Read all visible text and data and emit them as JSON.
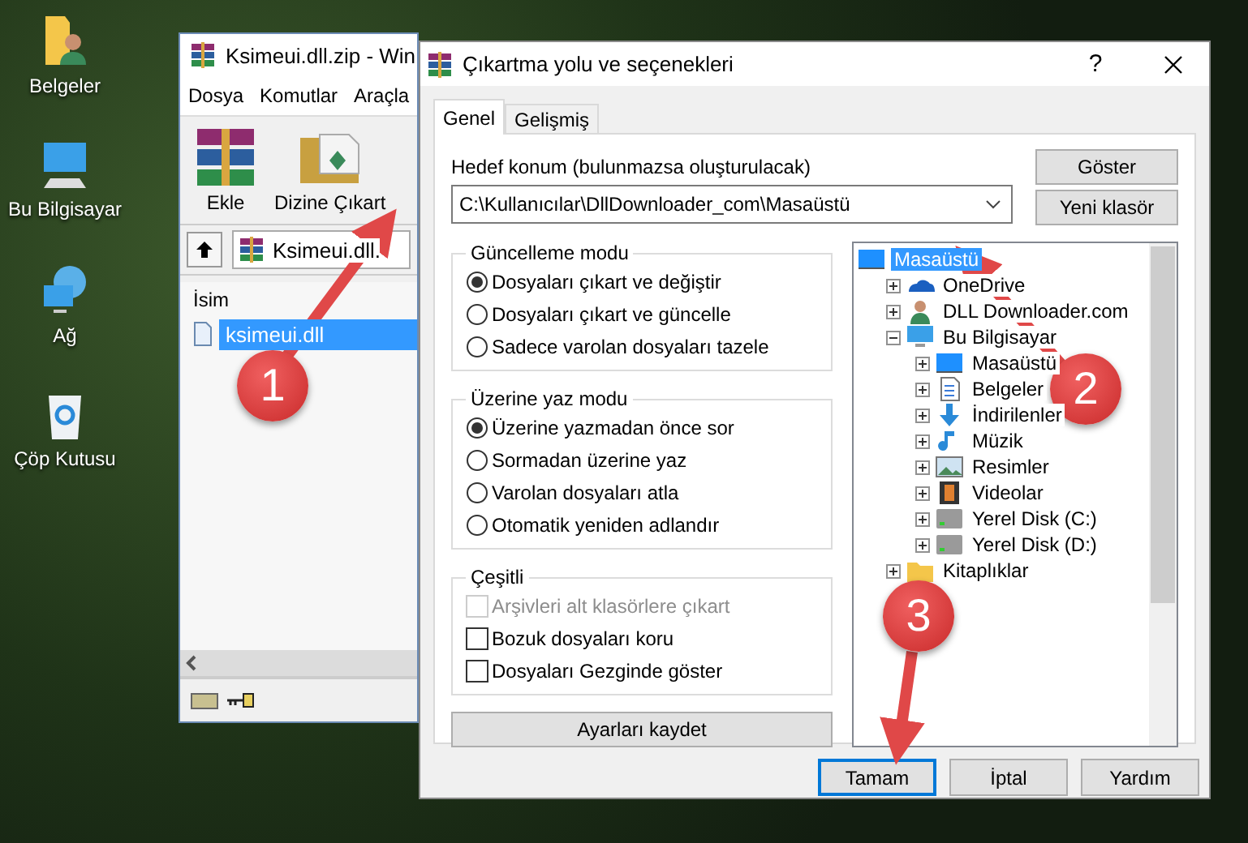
{
  "desktop_icons": [
    {
      "kind": "user-folder",
      "label": "Belgeler"
    },
    {
      "kind": "computer",
      "label": "Bu Bilgisayar"
    },
    {
      "kind": "network",
      "label": "Ağ"
    },
    {
      "kind": "recycle",
      "label": "Çöp Kutusu"
    }
  ],
  "archive_window": {
    "title": "Ksimeui.dll.zip - Win",
    "menu": [
      "Dosya",
      "Komutlar",
      "Araçla"
    ],
    "toolbar": [
      {
        "kind": "add",
        "label": "Ekle"
      },
      {
        "kind": "extract",
        "label": "Dizine Çıkart"
      }
    ],
    "path": "Ksimeui.dll.",
    "columns": [
      "İsim"
    ],
    "files": [
      {
        "name": "ksimeui.dll",
        "selected": true
      }
    ]
  },
  "dialog": {
    "title": "Çıkartma yolu ve seçenekleri",
    "help_button": "?",
    "tabs": [
      {
        "label": "Genel",
        "selected": true
      },
      {
        "label": "Gelişmiş",
        "selected": false
      }
    ],
    "destination_label": "Hedef konum (bulunmazsa oluşturulacak)",
    "destination": "C:\\Kullanıcılar\\DllDownloader_com\\Masaüstü",
    "side_buttons": [
      "Göster",
      "Yeni klasör"
    ],
    "groups": [
      {
        "kind": "radio",
        "title": "Güncelleme modu",
        "options": [
          {
            "label": "Dosyaları çıkart ve değiştir",
            "selected": true
          },
          {
            "label": "Dosyaları çıkart ve güncelle",
            "selected": false
          },
          {
            "label": "Sadece varolan dosyaları tazele",
            "selected": false
          }
        ]
      },
      {
        "kind": "radio",
        "title": "Üzerine yaz modu",
        "options": [
          {
            "label": "Üzerine yazmadan önce sor",
            "selected": true
          },
          {
            "label": "Sormadan üzerine yaz",
            "selected": false
          },
          {
            "label": "Varolan dosyaları atla",
            "selected": false
          },
          {
            "label": "Otomatik yeniden adlandır",
            "selected": false
          }
        ]
      },
      {
        "kind": "check",
        "title": "Çeşitli",
        "options": [
          {
            "label": "Arşivleri alt klasörlere çıkart",
            "checked": false,
            "disabled": true
          },
          {
            "label": "Bozuk dosyaları koru",
            "checked": false,
            "disabled": false
          },
          {
            "label": "Dosyaları Gezginde göster",
            "checked": false,
            "disabled": false
          }
        ]
      }
    ],
    "save_button": "Ayarları kaydet",
    "tree": [
      {
        "kind": "desktop",
        "label": "Masaüstü",
        "selected": true,
        "children": [
          {
            "kind": "cloud",
            "label": "OneDrive",
            "selected": false,
            "expanded": false
          },
          {
            "kind": "user",
            "label": "DLL Downloader.com",
            "selected": false,
            "expanded": false
          },
          {
            "kind": "computer",
            "label": "Bu Bilgisayar",
            "selected": false,
            "expanded": true,
            "children": [
              {
                "kind": "desktop",
                "label": "Masaüstü",
                "selected": false,
                "expanded": false
              },
              {
                "kind": "documents",
                "label": "Belgeler",
                "selected": false,
                "expanded": false
              },
              {
                "kind": "downloads",
                "label": "İndirilenler",
                "selected": false,
                "expanded": false
              },
              {
                "kind": "music",
                "label": "Müzik",
                "selected": false,
                "expanded": false
              },
              {
                "kind": "pictures",
                "label": "Resimler",
                "selected": false,
                "expanded": false
              },
              {
                "kind": "videos",
                "label": "Videolar",
                "selected": false,
                "expanded": false
              },
              {
                "kind": "disk",
                "label": "Yerel Disk (C:)",
                "selected": false,
                "expanded": false
              },
              {
                "kind": "disk",
                "label": "Yerel Disk (D:)",
                "selected": false,
                "expanded": false
              }
            ]
          },
          {
            "kind": "library",
            "label": "Kitaplıklar",
            "selected": false,
            "expanded": false
          }
        ]
      }
    ],
    "footer_buttons": [
      {
        "label": "Tamam",
        "selected": true
      },
      {
        "label": "İptal",
        "selected": false
      },
      {
        "label": "Yardım",
        "selected": false
      }
    ]
  },
  "annotations": [
    {
      "number": "1"
    },
    {
      "number": "2"
    },
    {
      "number": "3"
    }
  ]
}
